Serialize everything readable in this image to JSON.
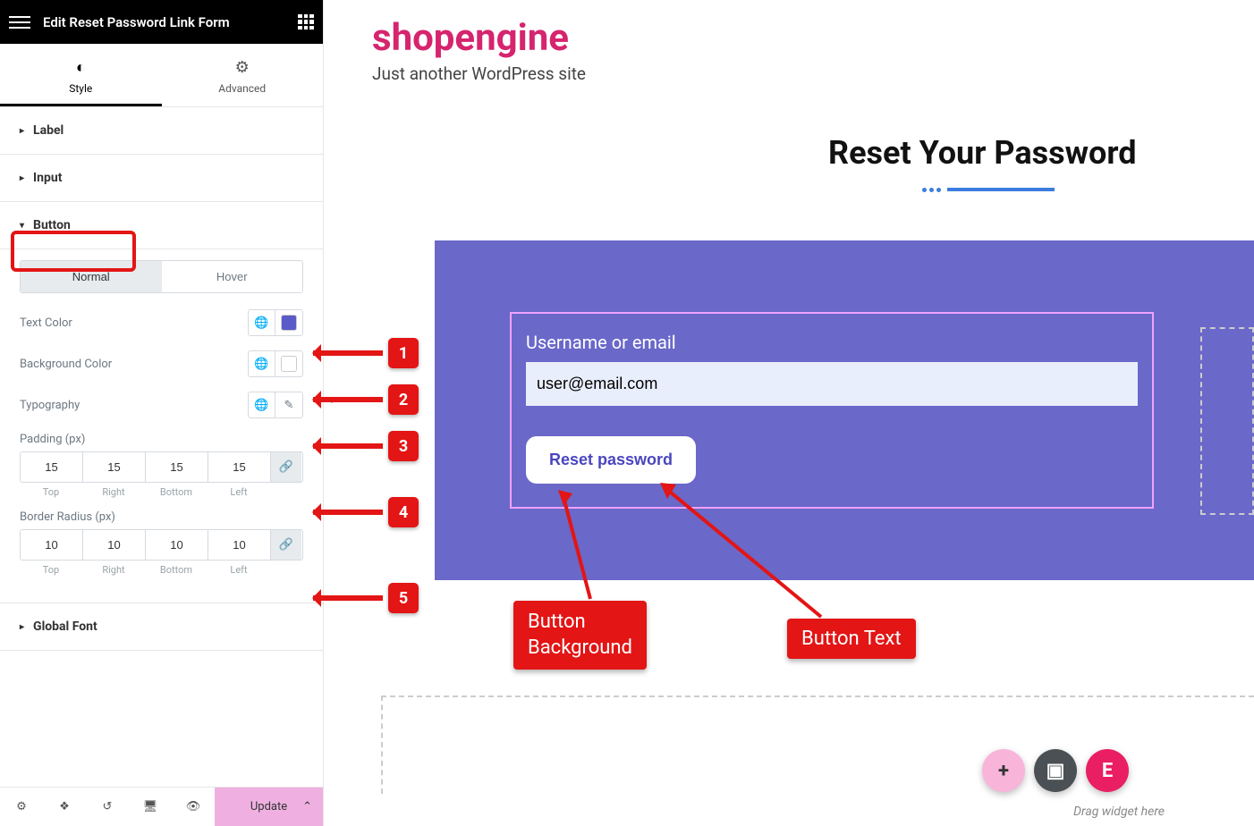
{
  "header": {
    "title": "Edit Reset Password Link Form"
  },
  "tabs": {
    "style": "Style",
    "advanced": "Advanced"
  },
  "sections": {
    "label": "Label",
    "input": "Input",
    "button": "Button",
    "global_font": "Global Font"
  },
  "btn_tabs": {
    "normal": "Normal",
    "hover": "Hover"
  },
  "controls": {
    "text_color": {
      "label": "Text Color",
      "value": "#5a5ac8"
    },
    "bg_color": {
      "label": "Background Color",
      "value": "#ffffff"
    },
    "typography": {
      "label": "Typography"
    },
    "padding": {
      "label": "Padding (px)",
      "top": "15",
      "right": "15",
      "bottom": "15",
      "left": "15",
      "lbl_top": "Top",
      "lbl_right": "Right",
      "lbl_bottom": "Bottom",
      "lbl_left": "Left"
    },
    "radius": {
      "label": "Border Radius (px)",
      "top": "10",
      "right": "10",
      "bottom": "10",
      "left": "10"
    }
  },
  "footer": {
    "update": "Update"
  },
  "preview": {
    "site_title": "shopengine",
    "tagline": "Just another WordPress site",
    "heading": "Reset Your Password",
    "form_label": "Username or email",
    "input_value": "user@email.com",
    "button_label": "Reset password",
    "drag_hint": "Drag widget here"
  },
  "annotations": {
    "n1": "1",
    "n2": "2",
    "n3": "3",
    "n4": "4",
    "n5": "5",
    "button_bg": "Button\nBackground",
    "button_text": "Button Text"
  }
}
